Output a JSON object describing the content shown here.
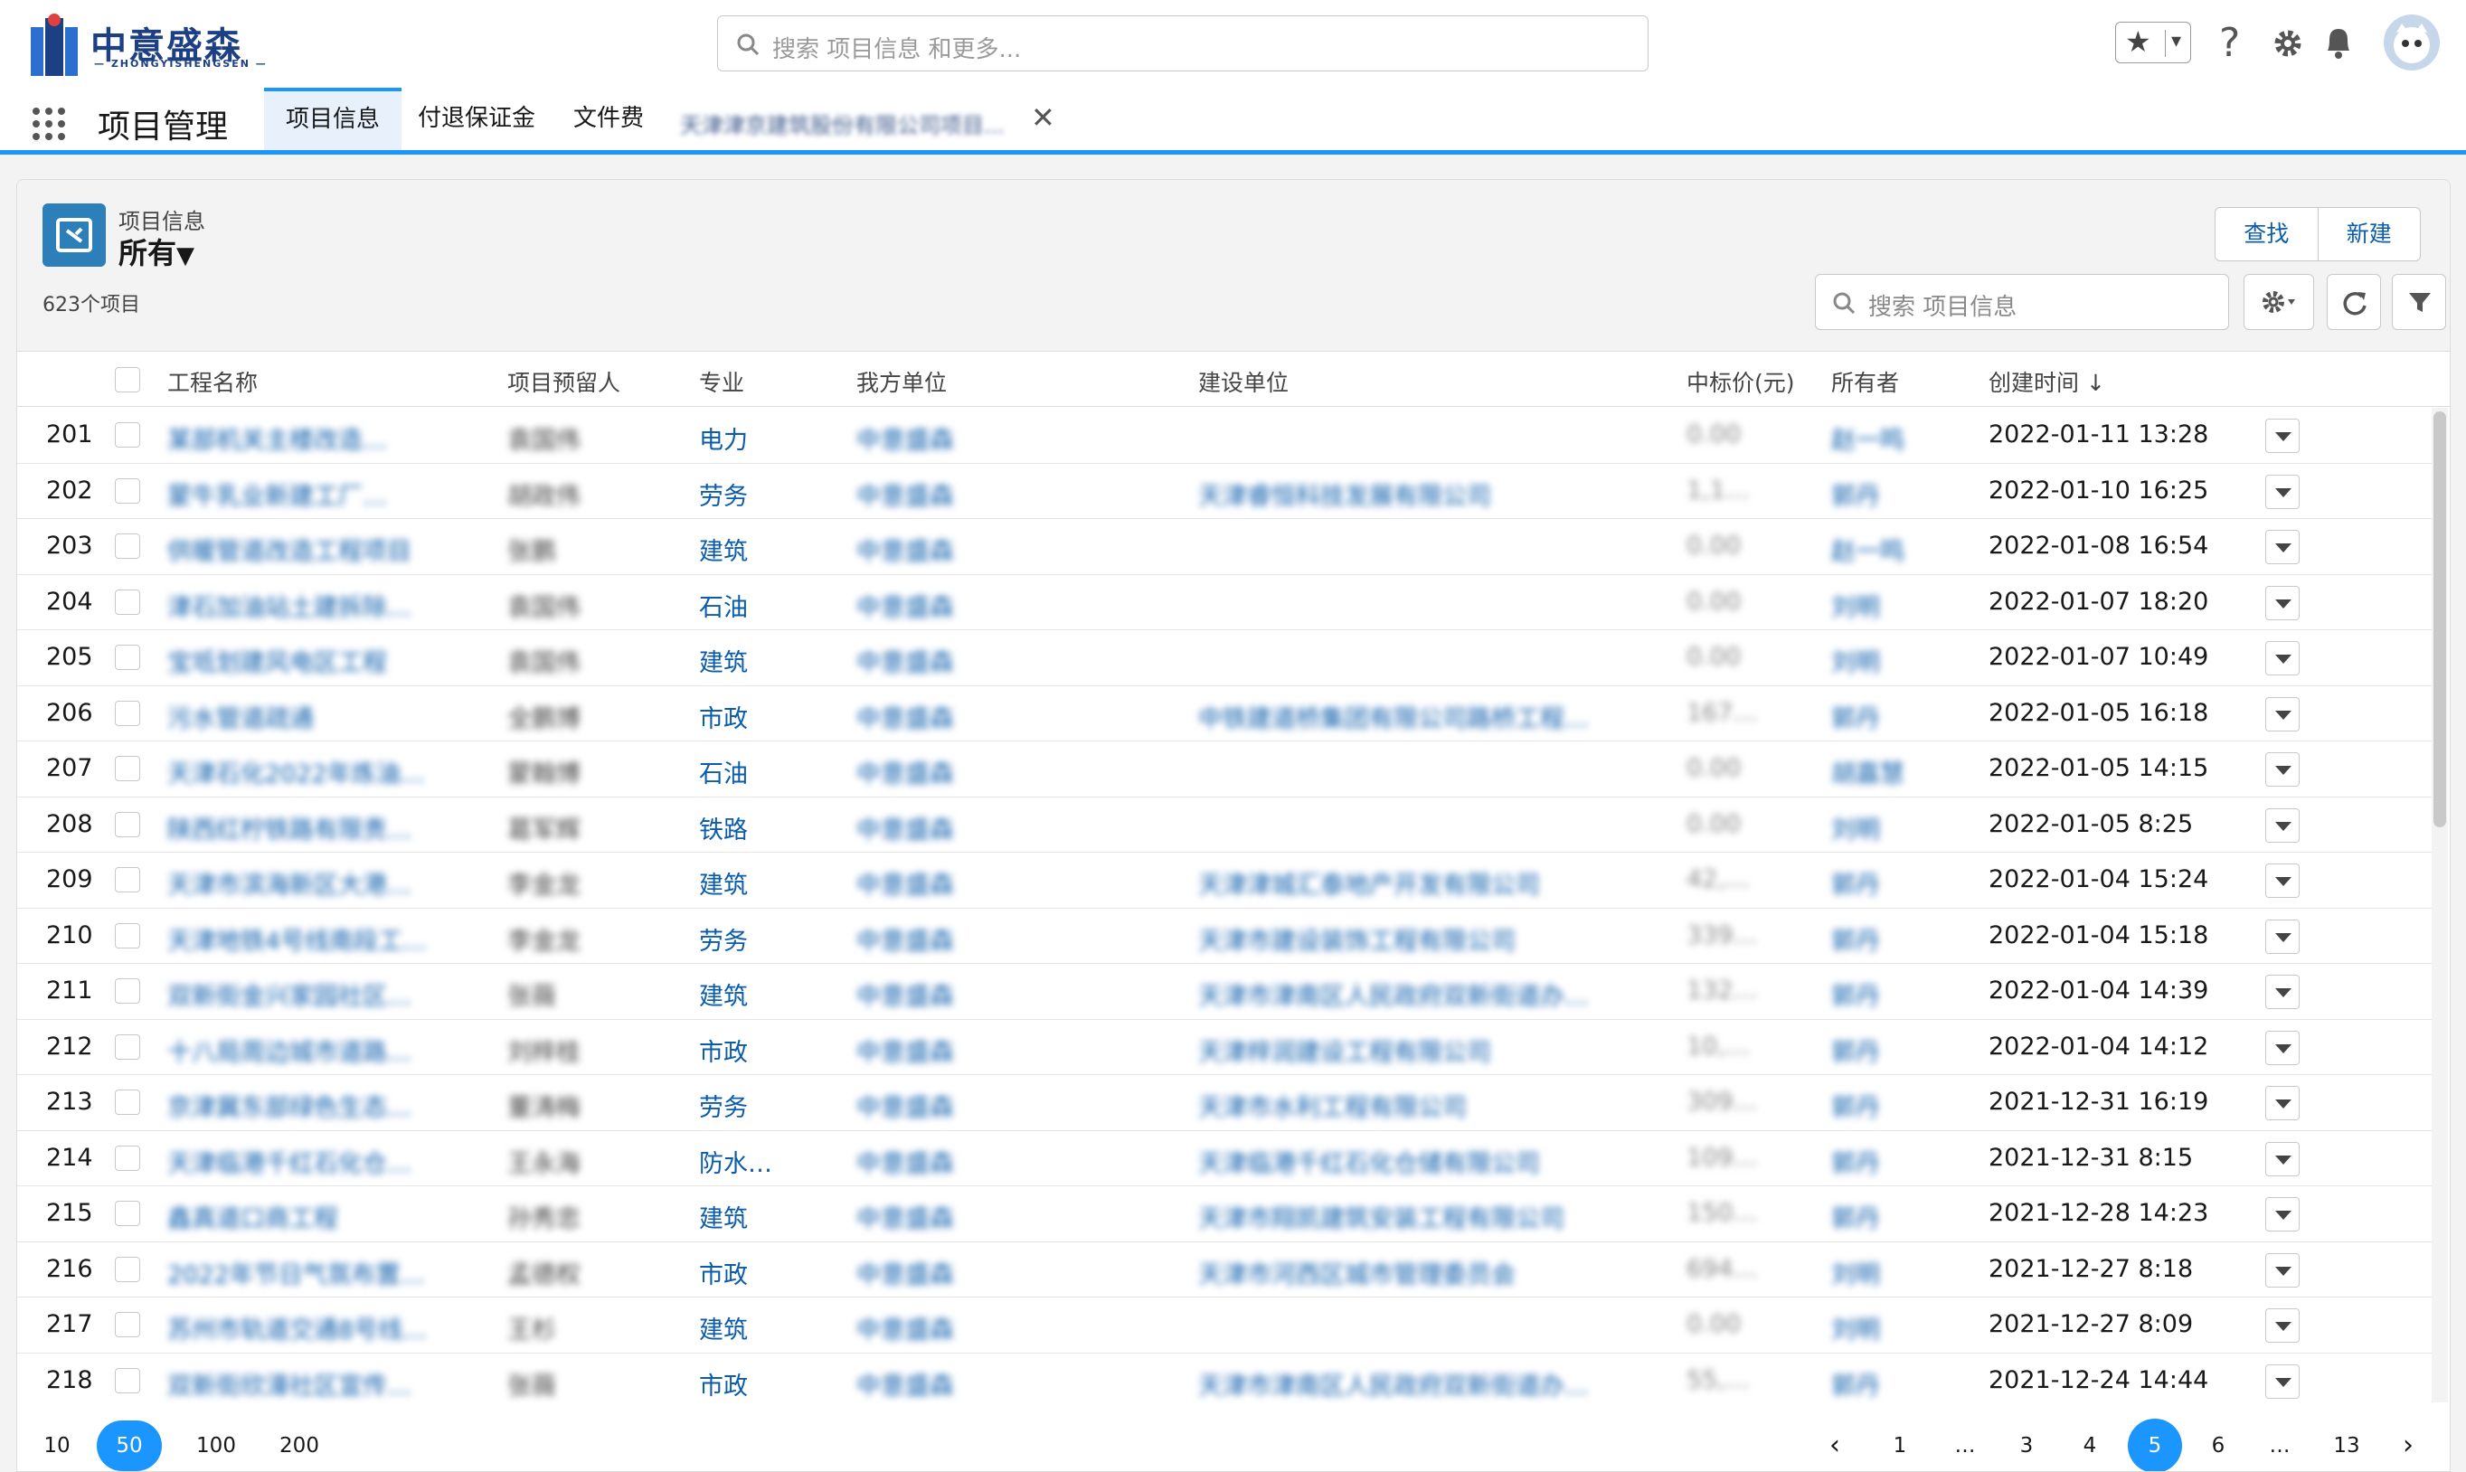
{
  "brand": {
    "name_cn": "中意盛森",
    "name_en": "— ZHONGYISHENGSEN —",
    "color": "#1d3f83"
  },
  "global_search": {
    "placeholder": "搜索 项目信息 和更多..."
  },
  "header_icons": [
    "star-icon",
    "help-icon",
    "gear-icon",
    "bell-icon",
    "avatar"
  ],
  "nav": {
    "app_name": "项目管理",
    "tabs": [
      {
        "label": "项目信息",
        "active": true
      },
      {
        "label": "付退保证金"
      },
      {
        "label": "文件费"
      }
    ],
    "blurred_tab": "天津津京建筑股份有限公司项目..."
  },
  "list": {
    "object_label": "项目信息",
    "view_name": "所有",
    "item_count": "623个项目",
    "buttons": {
      "find": "查找",
      "new": "新建"
    },
    "search_placeholder": "搜索 项目信息"
  },
  "columns": [
    "工程名称",
    "项目预留人",
    "专业",
    "我方单位",
    "建设单位",
    "中标价(元)",
    "所有者",
    "创建时间"
  ],
  "sort_indicator": "↓",
  "rows": [
    {
      "num": "201",
      "name": "某部机关主楼改造…",
      "person": "袁国伟",
      "major": "电力",
      "unit": "中意盛森",
      "client": "",
      "price": "0.00",
      "owner": "赵一鸣",
      "created": "2022-01-11 13:28"
    },
    {
      "num": "202",
      "name": "蒙牛乳业新建工厂…",
      "person": "胡政伟",
      "major": "劳务",
      "unit": "中意盛森",
      "client": "天津睿恒科技发展有限公司",
      "price": "1,1…",
      "owner": "郭丹",
      "created": "2022-01-10 16:25"
    },
    {
      "num": "203",
      "name": "供暖管道改造工程项目",
      "person": "张鹏",
      "major": "建筑",
      "unit": "中意盛森",
      "client": "",
      "price": "0.00",
      "owner": "赵一鸣",
      "created": "2022-01-08 16:54"
    },
    {
      "num": "204",
      "name": "津石加油站土建拆除…",
      "person": "袁国伟",
      "major": "石油",
      "unit": "中意盛森",
      "client": "",
      "price": "0.00",
      "owner": "刘明",
      "created": "2022-01-07 18:20"
    },
    {
      "num": "205",
      "name": "宝坻划建风电区工程",
      "person": "袁国伟",
      "major": "建筑",
      "unit": "中意盛森",
      "client": "",
      "price": "0.00",
      "owner": "刘明",
      "created": "2022-01-07 10:49"
    },
    {
      "num": "206",
      "name": "污水管道疏通",
      "person": "全鹏博",
      "major": "市政",
      "unit": "中意盛森",
      "client": "中铁建道桥集团有限公司路桥工程…",
      "price": "167…",
      "owner": "郭丹",
      "created": "2022-01-05 16:18"
    },
    {
      "num": "207",
      "name": "天津石化2022年炼油…",
      "person": "蒙翰博",
      "major": "石油",
      "unit": "中意盛森",
      "client": "",
      "price": "0.00",
      "owner": "胡嘉慧",
      "created": "2022-01-05 14:15"
    },
    {
      "num": "208",
      "name": "陕西红柠铁路有限责…",
      "person": "葛军辉",
      "major": "铁路",
      "unit": "中意盛森",
      "client": "",
      "price": "0.00",
      "owner": "刘明",
      "created": "2022-01-05 8:25"
    },
    {
      "num": "209",
      "name": "天津市滨海新区大港…",
      "person": "李金龙",
      "major": "建筑",
      "unit": "中意盛森",
      "client": "天津津城汇泰地产开发有限公司",
      "price": "42,…",
      "owner": "郭丹",
      "created": "2022-01-04 15:24"
    },
    {
      "num": "210",
      "name": "天津地铁4号线南段工…",
      "person": "李金龙",
      "major": "劳务",
      "unit": "中意盛森",
      "client": "天津市建设装饰工程有限公司",
      "price": "339…",
      "owner": "郭丹",
      "created": "2022-01-04 15:18"
    },
    {
      "num": "211",
      "name": "双新街金兴家园社区…",
      "person": "张薇",
      "major": "建筑",
      "unit": "中意盛森",
      "client": "天津市津南区人民政府双新街道办…",
      "price": "132…",
      "owner": "郭丹",
      "created": "2022-01-04 14:39"
    },
    {
      "num": "212",
      "name": "十八局周边城市道路…",
      "person": "刘梓桂",
      "major": "市政",
      "unit": "中意盛森",
      "client": "天津梓润建设工程有限公司",
      "price": "10,…",
      "owner": "郭丹",
      "created": "2022-01-04 14:12"
    },
    {
      "num": "213",
      "name": "京津冀东部绿色生态…",
      "person": "董涛梅",
      "major": "劳务",
      "unit": "中意盛森",
      "client": "天津市水利工程有限公司",
      "price": "309…",
      "owner": "郭丹",
      "created": "2021-12-31 16:19"
    },
    {
      "num": "214",
      "name": "天津临港千红石化仓…",
      "person": "王永海",
      "major": "防水…",
      "unit": "中意盛森",
      "client": "天津临港千红石化仓储有限公司",
      "price": "109…",
      "owner": "郭丹",
      "created": "2021-12-31 8:15"
    },
    {
      "num": "215",
      "name": "鑫真道口商工程",
      "person": "孙秀忠",
      "major": "建筑",
      "unit": "中意盛森",
      "client": "天津市翔凯建筑安装工程有限公司",
      "price": "150…",
      "owner": "郭丹",
      "created": "2021-12-28 14:23"
    },
    {
      "num": "216",
      "name": "2022年节日气氛布置…",
      "person": "孟德权",
      "major": "市政",
      "unit": "中意盛森",
      "client": "天津市河西区城市管理委员会",
      "price": "694…",
      "owner": "刘明",
      "created": "2021-12-27 8:18"
    },
    {
      "num": "217",
      "name": "苏州市轨道交通8号线…",
      "person": "王杉",
      "major": "建筑",
      "unit": "中意盛森",
      "client": "",
      "price": "0.00",
      "owner": "刘明",
      "created": "2021-12-27 8:09"
    },
    {
      "num": "218",
      "name": "双新街欣濠社区宣传…",
      "person": "张薇",
      "major": "市政",
      "unit": "中意盛森",
      "client": "天津市津南区人民政府双新街道办…",
      "price": "55,…",
      "owner": "郭丹",
      "created": "2021-12-24 14:44"
    }
  ],
  "page_sizes": [
    "10",
    "50",
    "100",
    "200"
  ],
  "selected_page_size": "50",
  "pagination": {
    "prev": "‹",
    "next": "›",
    "pages": [
      "1",
      "…",
      "3",
      "4",
      "5",
      "6",
      "…",
      "13"
    ],
    "current": "5"
  },
  "colors": {
    "accent": "#1b96ff",
    "link": "#0b5cab",
    "object_icon": "#2c7fb8"
  }
}
